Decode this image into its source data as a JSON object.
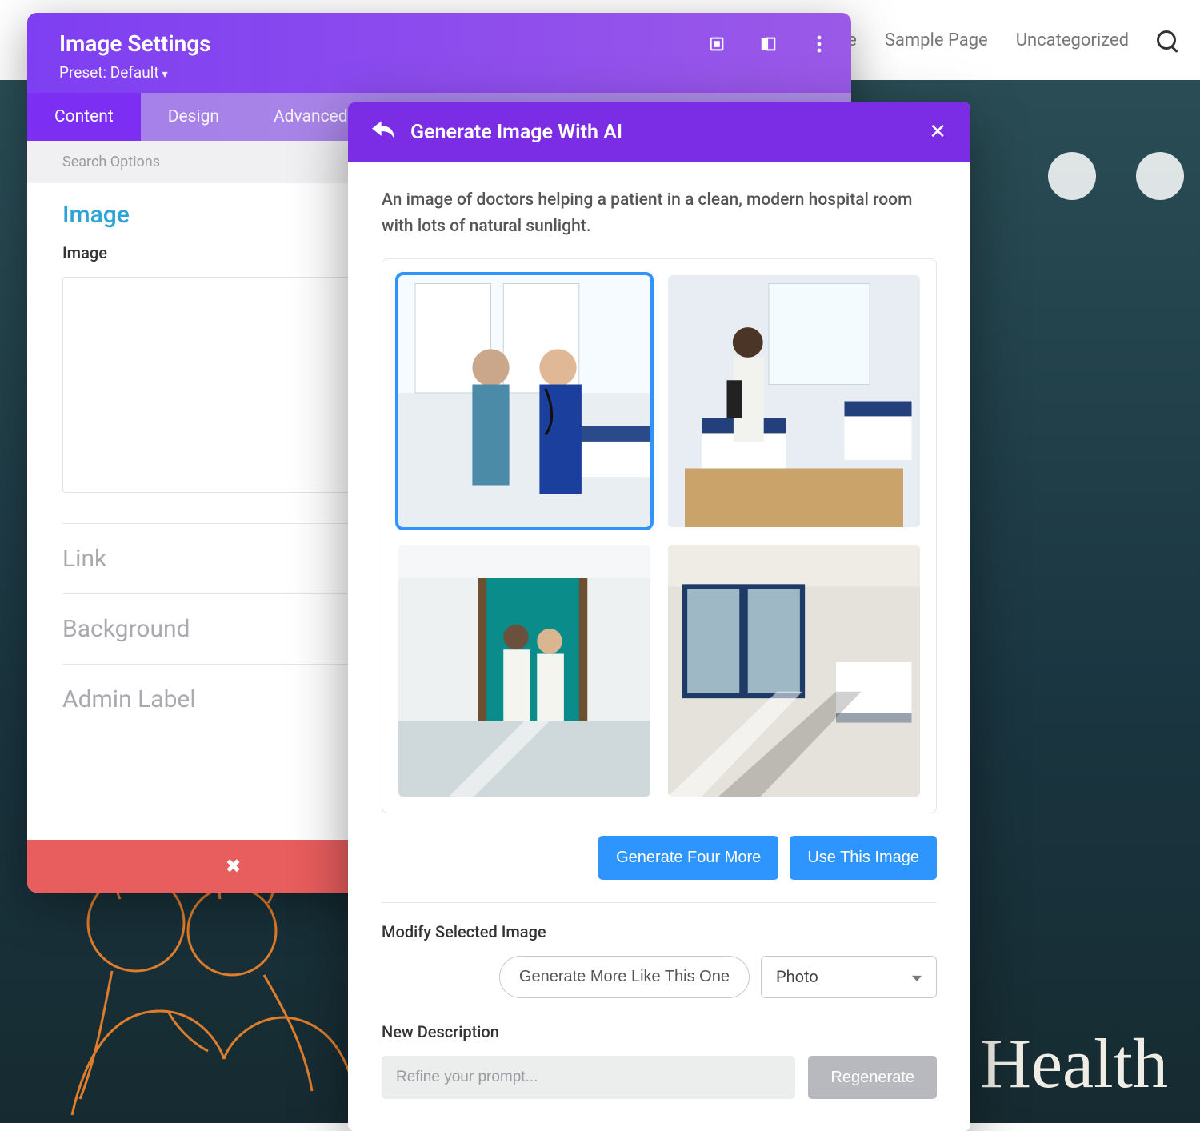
{
  "backgroundNav": {
    "items": [
      "ple",
      "Sample Page",
      "Uncategorized"
    ]
  },
  "hero": {
    "titleFragment": "i Health"
  },
  "settingsPanel": {
    "title": "Image Settings",
    "presetLabel": "Preset: Default",
    "tabs": [
      "Content",
      "Design",
      "Advanced"
    ],
    "activeTabIndex": 0,
    "searchPlaceholder": "Search Options",
    "activeSection": "Image",
    "imageFieldLabel": "Image",
    "collapsedSections": [
      "Link",
      "Background",
      "Admin Label"
    ]
  },
  "aiModal": {
    "title": "Generate Image With AI",
    "promptText": "An image of doctors helping a patient in a clean, modern hospital room with lots of natural sunlight.",
    "selectedIndex": 0,
    "buttons": {
      "generateMore": "Generate Four More",
      "useThis": "Use This Image"
    },
    "modifyLabel": "Modify Selected Image",
    "moreLikeThis": "Generate More Like This One",
    "styleSelectValue": "Photo",
    "newDescriptionLabel": "New Description",
    "refinePlaceholder": "Refine your prompt...",
    "regenerateLabel": "Regenerate"
  }
}
